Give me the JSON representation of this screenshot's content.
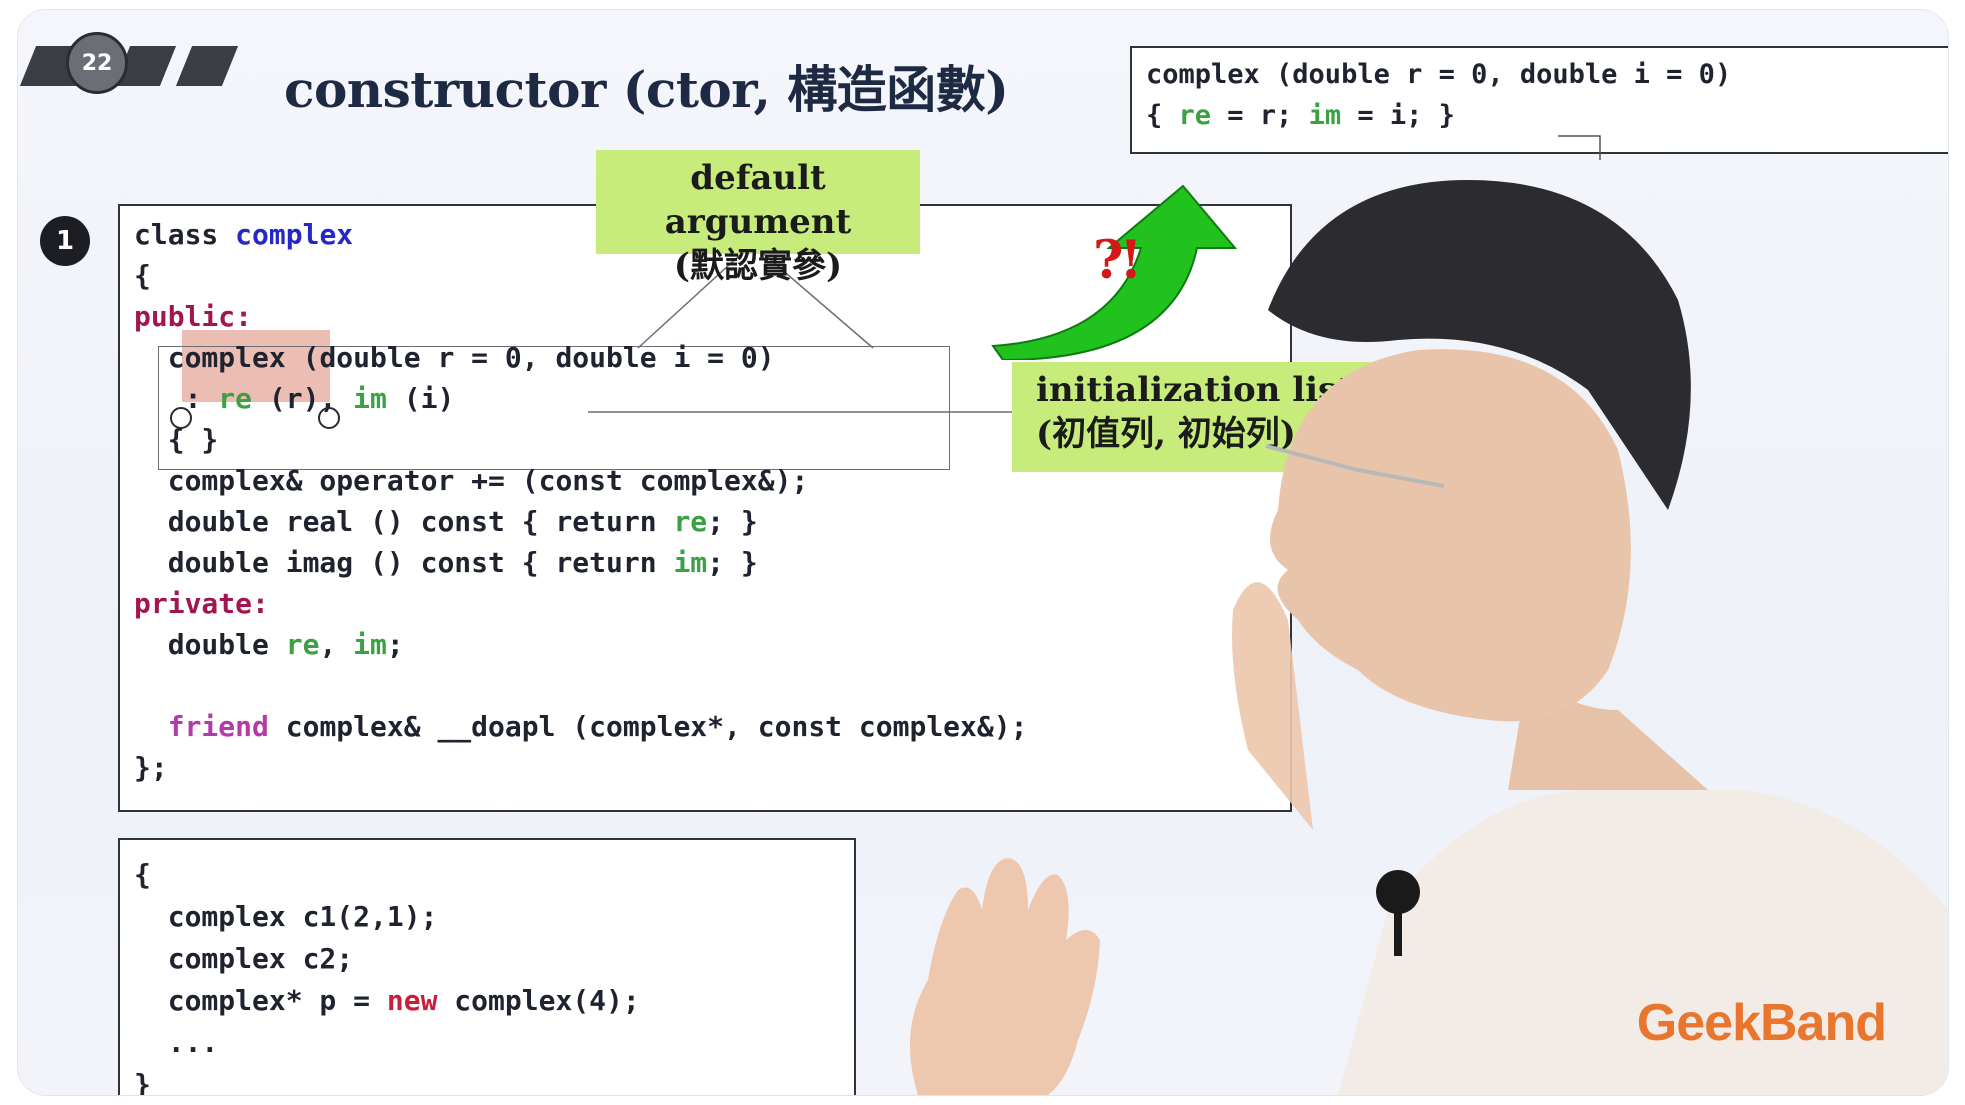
{
  "slide": {
    "number": "22",
    "title": "constructor (ctor, 構造函數)"
  },
  "marker": "1",
  "top_right_code": {
    "line1": "complex (double r = 0, double i = 0)",
    "line2": {
      "open": "{ ",
      "re": "re",
      "mid": " = r; ",
      "im": "im",
      "close": " = i; }"
    }
  },
  "callouts": {
    "default_argument": {
      "line1": "default argument",
      "line2": "(默認實參)"
    },
    "init_list": {
      "line1": "initialization list",
      "line2": "(初值列, 初始列)"
    },
    "interrobang": "?!"
  },
  "class_code": {
    "l1_kw": "class",
    "l1_name": "complex",
    "l2": "{",
    "public": "public:",
    "l4_a": "complex",
    "l4_b": " (double r = 0, double i = 0)",
    "l5_a": " : ",
    "l5_re": "re",
    "l5_b": " (r), ",
    "l5_im": "im",
    "l5_c": " (i)",
    "l6": "{ }",
    "l7": "complex& operator += (const complex&);",
    "l8_a": "double real () const { return ",
    "l8_re": "re",
    "l8_b": "; }",
    "l9_a": "double imag () const { return ",
    "l9_im": "im",
    "l9_b": "; }",
    "private": "private:",
    "l11_a": "double ",
    "l11_re": "re",
    "l11_b": ", ",
    "l11_im": "im",
    "l11_c": ";",
    "l13_kw": "friend",
    "l13_rest": " complex& __doapl (complex*, const complex&);",
    "l14": "};"
  },
  "usage_code": {
    "l1": "{",
    "l2": "complex c1(2,1);",
    "l3": "complex c2;",
    "l4_a": "complex* p = ",
    "l4_new": "new",
    "l4_b": " complex(4);",
    "l5": "...",
    "l6": "}"
  },
  "logo": "GeekBand",
  "colors": {
    "keyword_blue": "#2727c9",
    "access_red": "#a3154e",
    "member_green": "#3aa145",
    "friend_magenta": "#b33aa8",
    "callout_green": "#c7ec7c",
    "arrow_green": "#22c21e",
    "logo_orange": "#e8762f"
  }
}
